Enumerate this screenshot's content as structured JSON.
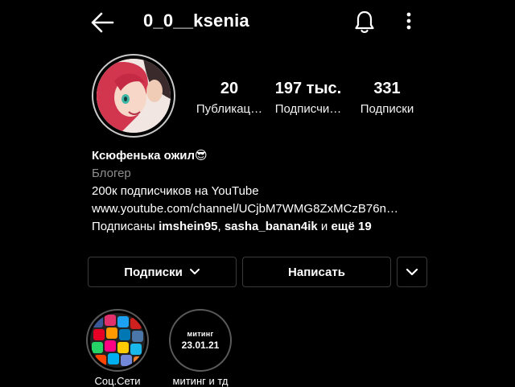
{
  "header": {
    "username": "0_0__ksenia",
    "icons": [
      "arrow-left-icon",
      "bell-icon",
      "more-vertical-icon"
    ]
  },
  "stats": {
    "posts": {
      "value": "20",
      "label": "Публикац…"
    },
    "followers": {
      "value": "197 тыс.",
      "label": "Подписчи…"
    },
    "following": {
      "value": "331",
      "label": "Подписки"
    }
  },
  "bio": {
    "name": "Ксюфенька ожил😎",
    "category": "Блогер",
    "text": "200к подписчиков на YouTube",
    "link": "www.youtube.com/channel/UCjbM7WMG8ZxMCzB76n…",
    "followed_prefix": "Подписаны ",
    "followed_user1": "imshein95",
    "followed_sep": ", ",
    "followed_user2": "sasha_banan4ik",
    "followed_and": " и ",
    "followed_more": "ещё 19"
  },
  "buttons": {
    "following": "Подписки",
    "message": "Написать"
  },
  "highlights": [
    {
      "label": "Соц.Сети"
    },
    {
      "label": "митинг и тд",
      "cover_title": "митинг",
      "cover_date": "23.01.21"
    }
  ],
  "colors": {
    "background": "#000000",
    "text": "#ffffff",
    "muted": "#8e8e8e",
    "border": "#3a3a3a"
  }
}
